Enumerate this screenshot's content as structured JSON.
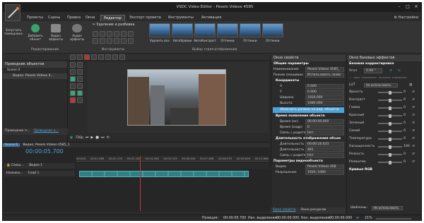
{
  "window": {
    "title": "VSDC Video Editor - Pexels Videos 4585"
  },
  "menu_tabs": [
    "Проекты",
    "Сцены",
    "Правка",
    "Окна",
    "Редактор",
    "Экспорт проекта",
    "Инструменты",
    "Активация"
  ],
  "active_tab": "Редактор",
  "settings_label": "Настройки",
  "ribbon": {
    "run_label": "Запустить помощника",
    "add_object_label": "Добавить объект",
    "video_effects_label": "Видео эффекты",
    "audio_effects_label": "Аудио эффекты",
    "group_editing": "Редактирование",
    "delete_split": "Удаление и разбивка",
    "group_tools": "Инструменты",
    "styles": [
      "Удалить все",
      "АвтоУровни",
      "АвтоКонтраст",
      "Оттенки",
      "Оттенки",
      "Оттенки"
    ],
    "group_styles": "Выбор стиля отображения"
  },
  "object_explorer": {
    "title": "Проводник объектов",
    "items": [
      "Scene 0",
      "Видео: Pexels Videos 4..."
    ],
    "bottom_tabs": [
      "Проводник п...",
      "Проводник о..."
    ]
  },
  "preview": {
    "zoom": "720p"
  },
  "timeline": {
    "crumbs": [
      "Scene 0",
      "Видео: Pexels Videos 4585_1"
    ],
    "timecode": "00:00:05.700",
    "ticks": [
      "00:000",
      "00:01.066",
      "00:02.133",
      "00:03.200",
      "00:04.266",
      "00:05.333",
      "00:06.400",
      "00:07.466",
      "00:08.533",
      "00:09.600",
      "00:10.666"
    ],
    "track1": {
      "name": "Видео 1",
      "blend": "Смеш..."
    },
    "track2": {
      "name": "Слой 1",
      "blend": "Наложи..."
    }
  },
  "properties": {
    "title": "Окно свойств",
    "general": "Общие параметры",
    "rows": [
      {
        "label": "Наименование",
        "value": "Pexels Videos 4585_"
      },
      {
        "label": "Режим смешиван",
        "value": "Использовать свойс"
      }
    ],
    "coords": "Координаты",
    "coord_rows": [
      {
        "label": "X",
        "value": "0.000"
      },
      {
        "label": "Y",
        "value": "0.000"
      },
      {
        "label": "Ширина",
        "value": "1920.000"
      },
      {
        "label": "Высота",
        "value": "1080.000"
      }
    ],
    "resize_btn": "Изменить размер на род. объекта",
    "time_section": "Время появления объекта",
    "time_rows": [
      {
        "label": "Время (мс)",
        "value": "00:00:00.000"
      },
      {
        "label": "Время (кадр)",
        "value": "0"
      },
      {
        "label": "Связь с родител",
        "value": "Нет"
      }
    ],
    "duration_section": "Длительность отображения объек",
    "duration_rows": [
      {
        "label": "Длительность (м",
        "value": "00:00:16.033"
      },
      {
        "label": "Длительность (к",
        "value": "481"
      },
      {
        "label": "Связь с родител",
        "value": "Нет"
      }
    ],
    "video_section": "Параметры видеообъекта",
    "video_rows": [
      {
        "label": "Видео",
        "value": "Pexels Videos 458"
      },
      {
        "label": "Разрешение",
        "value": "1920; 1080"
      }
    ],
    "bottom_tabs": [
      "Окно свойств",
      "Окно ресурсов"
    ]
  },
  "effects": {
    "title": "Окно базовых эффектов",
    "section": "Базовая корректировка",
    "vibrance_label": "Угол",
    "vibrance_value": "0.00 °",
    "presets": [
      "...",
      "прот. отраженно",
      "нуть/отр. отражение"
    ],
    "lut_label": "LUT",
    "lut_value": "Не использовать",
    "sliders": [
      {
        "label": "Яркость",
        "value": "0"
      },
      {
        "label": "Контраст",
        "value": "0"
      },
      {
        "label": "Гамма",
        "value": "0"
      },
      {
        "label": "Красный",
        "value": "0"
      },
      {
        "label": "Зеленый",
        "value": "0"
      },
      {
        "label": "Синий",
        "value": "0"
      },
      {
        "label": "Температура",
        "value": "0"
      },
      {
        "label": "Насыщенность",
        "value": "100"
      },
      {
        "label": "Резкость",
        "value": "0"
      },
      {
        "label": "Размытие",
        "value": "0"
      }
    ],
    "curves_section": "Кривые RGB",
    "templates_label": "Шаблоны:",
    "templates_value": "Не использовать"
  },
  "statusbar": {
    "position_label": "Позиция:",
    "position_value": "00:00:05.700",
    "start_label": "Нач. выделения:",
    "start_value": "00:00:00.000",
    "end_label": "Кон. выделения:",
    "end_value": "00:00:00.000",
    "zoom": "21%"
  },
  "colors": {
    "accent": "#4fa3d9",
    "clip": "#2f7f86",
    "playhead": "#c0392b"
  }
}
